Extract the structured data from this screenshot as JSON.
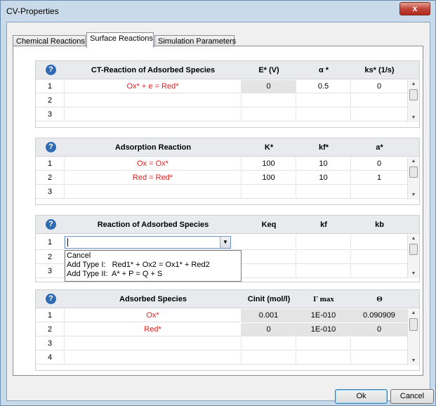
{
  "window": {
    "title": "CV-Properties",
    "close_label": "x"
  },
  "tabs": [
    {
      "label": "Chemical Reactions",
      "active": false
    },
    {
      "label": "Surface Reactions",
      "active": true
    },
    {
      "label": "Simulation Parameters",
      "active": false
    }
  ],
  "ct_grid": {
    "headers": [
      "CT-Reaction of Adsorbed Species",
      "E* (V)",
      "α *",
      "ks* (1/s)"
    ],
    "rows": [
      {
        "num": "1",
        "reaction": "Ox* + e = Red*",
        "c1": "0",
        "c2": "0.5",
        "c3": "0"
      },
      {
        "num": "2",
        "reaction": "",
        "c1": "",
        "c2": "",
        "c3": ""
      },
      {
        "num": "3",
        "reaction": "",
        "c1": "",
        "c2": "",
        "c3": ""
      }
    ]
  },
  "ads_grid": {
    "headers": [
      "Adsorption Reaction",
      "K*",
      "kf*",
      "a*"
    ],
    "rows": [
      {
        "num": "1",
        "reaction": "Ox = Ox*",
        "c1": "100",
        "c2": "10",
        "c3": "0"
      },
      {
        "num": "2",
        "reaction": "Red = Red*",
        "c1": "100",
        "c2": "10",
        "c3": "1"
      },
      {
        "num": "3",
        "reaction": "",
        "c1": "",
        "c2": "",
        "c3": ""
      }
    ]
  },
  "ras_grid": {
    "headers": [
      "Reaction of Adsorbed Species",
      "Keq",
      "kf",
      "kb"
    ],
    "rows": [
      {
        "num": "1",
        "reaction": "",
        "c1": "",
        "c2": "",
        "c3": ""
      },
      {
        "num": "2",
        "reaction": "",
        "c1": "",
        "c2": "",
        "c3": ""
      },
      {
        "num": "3",
        "reaction": "",
        "c1": "",
        "c2": "",
        "c3": ""
      }
    ],
    "combo_value": "",
    "dropdown_items": [
      "Cancel",
      "Add Type I:   Red1* + Ox2 = Ox1* + Red2",
      "Add Type II:  A* + P = Q + S"
    ]
  },
  "species_grid": {
    "headers": [
      "Adsorbed Species",
      "Cinit (mol/l)",
      "Γ max",
      "Θ"
    ],
    "rows": [
      {
        "num": "1",
        "reaction": "Ox*",
        "c1": "0.001",
        "c2": "1E-010",
        "c3": "0.090909"
      },
      {
        "num": "2",
        "reaction": "Red*",
        "c1": "0",
        "c2": "1E-010",
        "c3": "0"
      },
      {
        "num": "3",
        "reaction": "",
        "c1": "",
        "c2": "",
        "c3": ""
      },
      {
        "num": "4",
        "reaction": "",
        "c1": "",
        "c2": "",
        "c3": ""
      }
    ]
  },
  "buttons": {
    "ok": "Ok",
    "cancel": "Cancel"
  },
  "colors": {
    "species_text": "#e02020",
    "title_bar": "#c9daea"
  },
  "icons": {
    "help": "?"
  }
}
